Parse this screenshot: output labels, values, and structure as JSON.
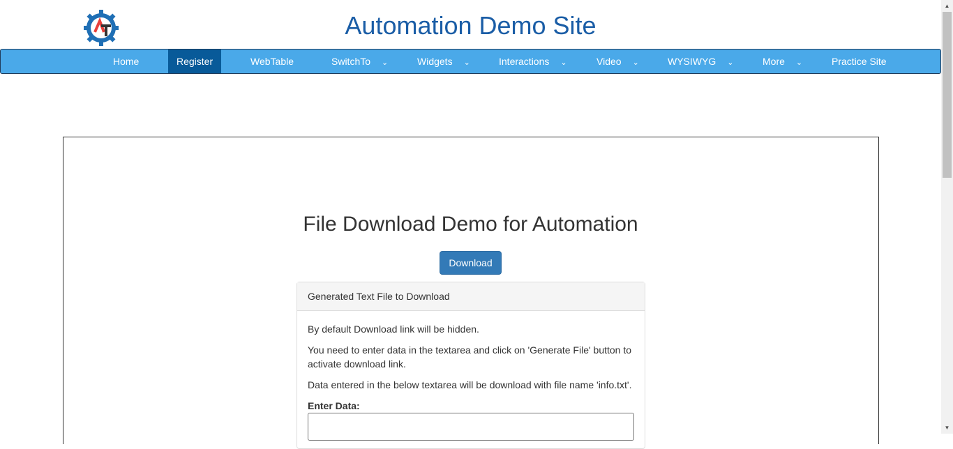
{
  "site": {
    "title": "Automation Demo Site"
  },
  "nav": {
    "items": [
      {
        "label": "Home"
      },
      {
        "label": "Register"
      },
      {
        "label": "WebTable"
      },
      {
        "label": "SwitchTo"
      },
      {
        "label": "Widgets"
      },
      {
        "label": "Interactions"
      },
      {
        "label": "Video"
      },
      {
        "label": "WYSIWYG"
      },
      {
        "label": "More"
      },
      {
        "label": "Practice Site"
      }
    ],
    "active": "Register"
  },
  "main": {
    "heading": "File Download Demo for Automation",
    "download_label": "Download",
    "panel": {
      "title": "Generated Text File to Download",
      "p1": "By default Download link will be hidden.",
      "p2": "You need to enter data in the textarea and click on 'Generate File' button to activate download link.",
      "p3": "Data entered in the below textarea will be download with file name 'info.txt'.",
      "field_label": "Enter Data:",
      "field_value": ""
    }
  },
  "colors": {
    "nav_bg": "#4aa9e9",
    "nav_active": "#085a99",
    "title": "#1a5da6",
    "button": "#337ab7"
  },
  "icons": {
    "logo": "gear-logo-icon",
    "dropdown": "chevron-down-icon"
  }
}
